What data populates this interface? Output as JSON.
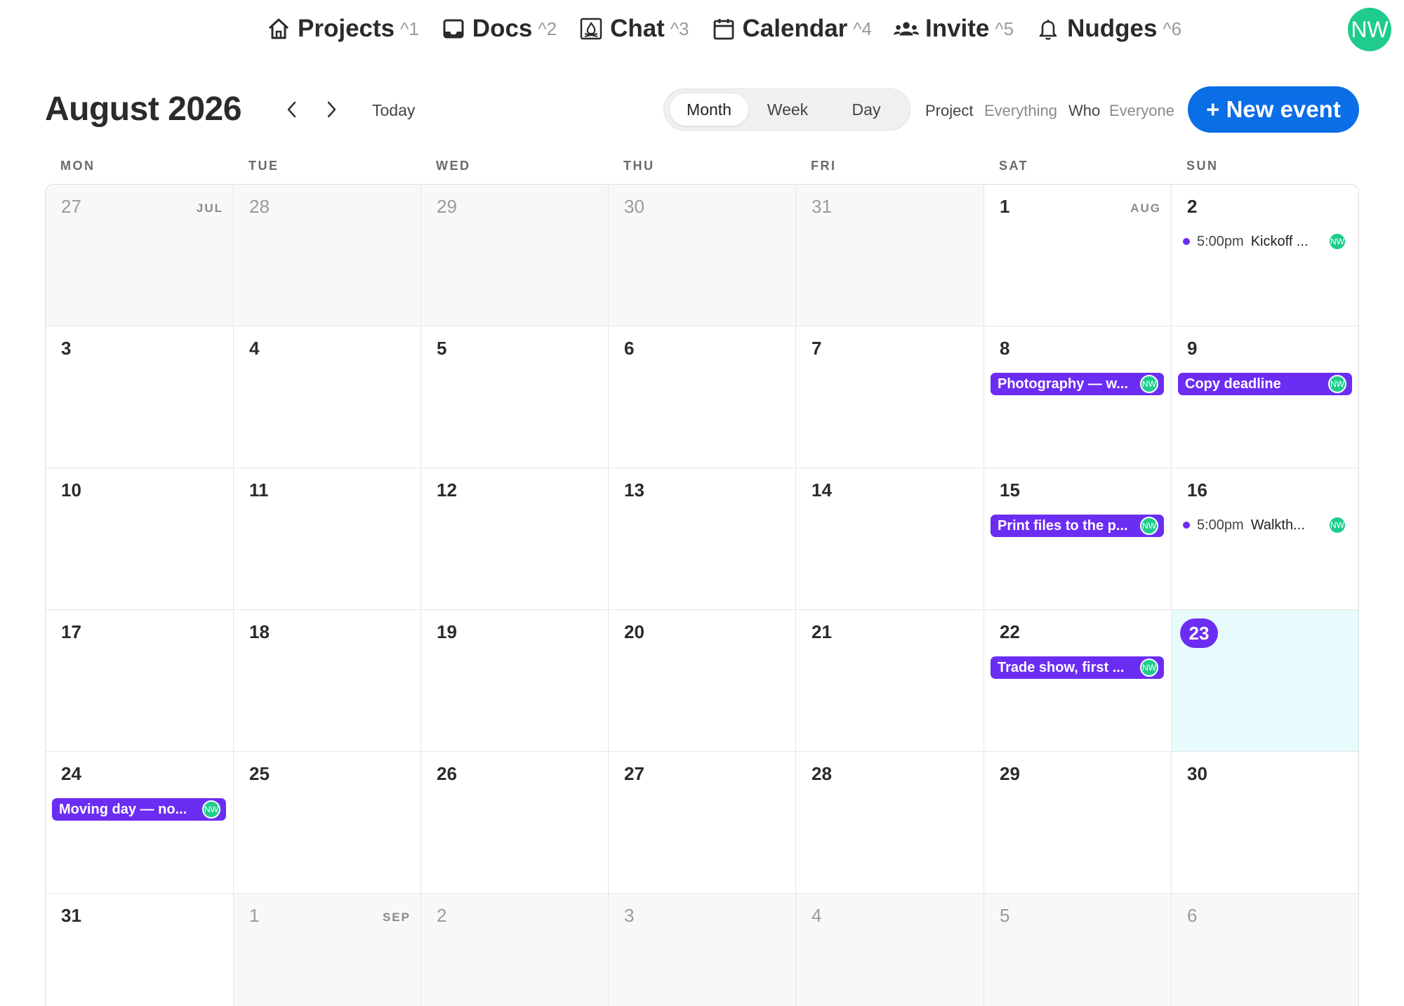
{
  "nav": {
    "items": [
      {
        "label": "Projects",
        "shortcut": "^1",
        "icon": "house-icon"
      },
      {
        "label": "Docs",
        "shortcut": "^2",
        "icon": "inbox-icon"
      },
      {
        "label": "Chat",
        "shortcut": "^3",
        "icon": "campfire-icon"
      },
      {
        "label": "Calendar",
        "shortcut": "^4",
        "icon": "calendar-icon"
      },
      {
        "label": "Invite",
        "shortcut": "^5",
        "icon": "people-icon"
      },
      {
        "label": "Nudges",
        "shortcut": "^6",
        "icon": "bell-icon"
      }
    ],
    "avatar": "NW"
  },
  "header": {
    "month_title": "August 2026",
    "prev_icon": "chevron-left-icon",
    "next_icon": "chevron-right-icon",
    "today": "Today",
    "views": [
      "Month",
      "Week",
      "Day"
    ],
    "active_view": "Month",
    "filters": {
      "project_label": "Project",
      "project_value": "Everything",
      "who_label": "Who",
      "who_value": "Everyone"
    },
    "new_event": "+ New event"
  },
  "colors": {
    "accent": "#6c2df2",
    "primary_button": "#0a6ee6",
    "avatar": "#1fcc8c",
    "today_bg": "#e8fbfc"
  },
  "weekdays": [
    "MON",
    "TUE",
    "WED",
    "THU",
    "FRI",
    "SAT",
    "SUN"
  ],
  "weeks": [
    [
      {
        "day": "27",
        "month_label": "JUL",
        "out": true
      },
      {
        "day": "28",
        "out": true
      },
      {
        "day": "29",
        "out": true
      },
      {
        "day": "30",
        "out": true
      },
      {
        "day": "31",
        "out": true
      },
      {
        "day": "1",
        "month_label": "AUG"
      },
      {
        "day": "2",
        "event": {
          "kind": "timed",
          "time": "5:00pm",
          "title": "Kickoff ...",
          "avatar": "NW"
        }
      }
    ],
    [
      {
        "day": "3"
      },
      {
        "day": "4"
      },
      {
        "day": "5"
      },
      {
        "day": "6"
      },
      {
        "day": "7"
      },
      {
        "day": "8",
        "event": {
          "kind": "allday",
          "title": "Photography — w...",
          "avatar": "NW"
        }
      },
      {
        "day": "9",
        "event": {
          "kind": "allday",
          "title": "Copy deadline",
          "avatar": "NW"
        }
      }
    ],
    [
      {
        "day": "10"
      },
      {
        "day": "11"
      },
      {
        "day": "12"
      },
      {
        "day": "13"
      },
      {
        "day": "14"
      },
      {
        "day": "15",
        "event": {
          "kind": "allday",
          "title": "Print files to the p...",
          "avatar": "NW"
        }
      },
      {
        "day": "16",
        "event": {
          "kind": "timed",
          "time": "5:00pm",
          "title": "Walkth...",
          "avatar": "NW"
        }
      }
    ],
    [
      {
        "day": "17"
      },
      {
        "day": "18"
      },
      {
        "day": "19"
      },
      {
        "day": "20"
      },
      {
        "day": "21"
      },
      {
        "day": "22",
        "event": {
          "kind": "allday",
          "title": "Trade show, first ...",
          "avatar": "NW"
        }
      },
      {
        "day": "23",
        "today": true
      }
    ],
    [
      {
        "day": "24",
        "event": {
          "kind": "allday",
          "title": "Moving day — no...",
          "avatar": "NW"
        }
      },
      {
        "day": "25"
      },
      {
        "day": "26"
      },
      {
        "day": "27"
      },
      {
        "day": "28"
      },
      {
        "day": "29"
      },
      {
        "day": "30"
      }
    ],
    [
      {
        "day": "31"
      },
      {
        "day": "1",
        "month_label": "SEP",
        "out": true
      },
      {
        "day": "2",
        "out": true
      },
      {
        "day": "3",
        "out": true
      },
      {
        "day": "4",
        "out": true
      },
      {
        "day": "5",
        "out": true
      },
      {
        "day": "6",
        "out": true
      }
    ]
  ]
}
